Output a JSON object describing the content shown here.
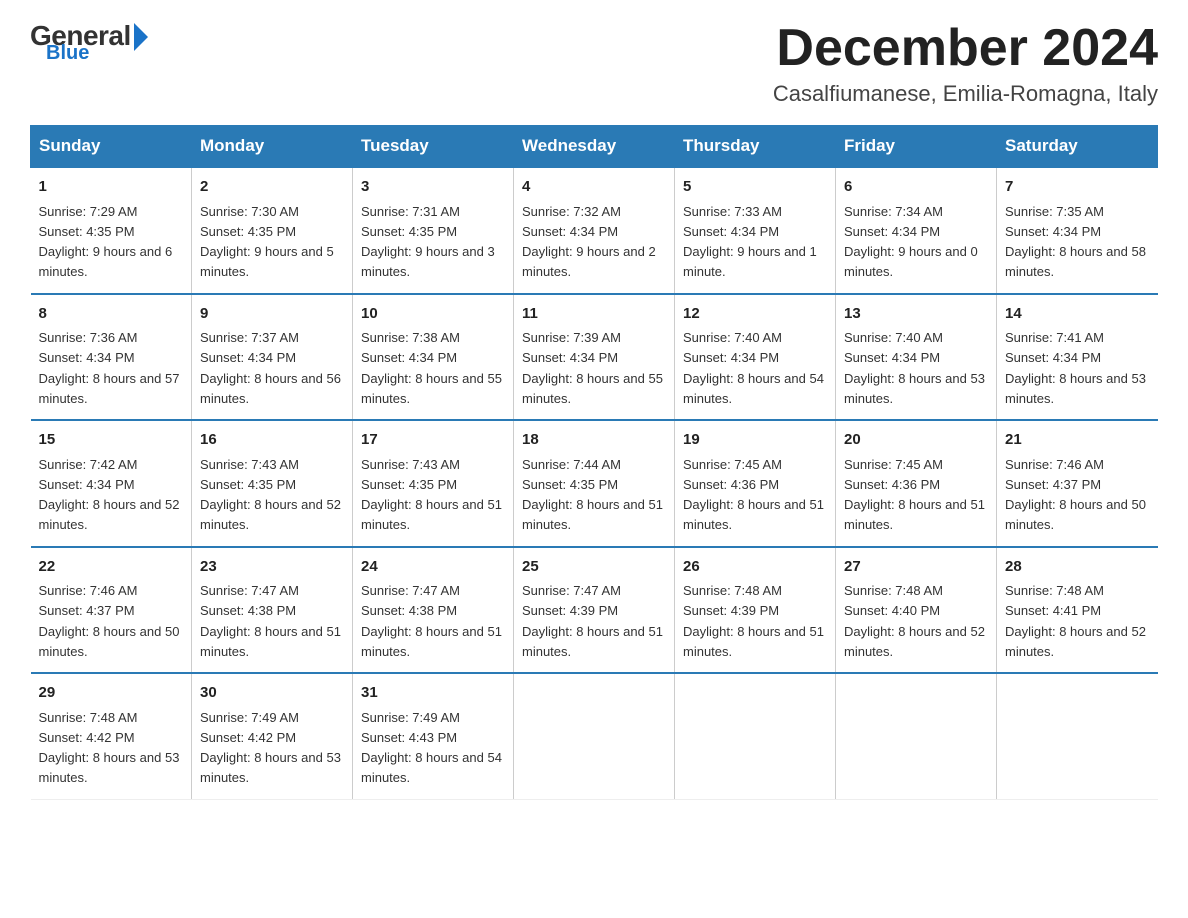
{
  "header": {
    "logo_general": "General",
    "logo_blue": "Blue",
    "month_title": "December 2024",
    "location": "Casalfiumanese, Emilia-Romagna, Italy"
  },
  "weekdays": [
    "Sunday",
    "Monday",
    "Tuesday",
    "Wednesday",
    "Thursday",
    "Friday",
    "Saturday"
  ],
  "weeks": [
    [
      {
        "day": "1",
        "sunrise": "7:29 AM",
        "sunset": "4:35 PM",
        "daylight": "9 hours and 6 minutes."
      },
      {
        "day": "2",
        "sunrise": "7:30 AM",
        "sunset": "4:35 PM",
        "daylight": "9 hours and 5 minutes."
      },
      {
        "day": "3",
        "sunrise": "7:31 AM",
        "sunset": "4:35 PM",
        "daylight": "9 hours and 3 minutes."
      },
      {
        "day": "4",
        "sunrise": "7:32 AM",
        "sunset": "4:34 PM",
        "daylight": "9 hours and 2 minutes."
      },
      {
        "day": "5",
        "sunrise": "7:33 AM",
        "sunset": "4:34 PM",
        "daylight": "9 hours and 1 minute."
      },
      {
        "day": "6",
        "sunrise": "7:34 AM",
        "sunset": "4:34 PM",
        "daylight": "9 hours and 0 minutes."
      },
      {
        "day": "7",
        "sunrise": "7:35 AM",
        "sunset": "4:34 PM",
        "daylight": "8 hours and 58 minutes."
      }
    ],
    [
      {
        "day": "8",
        "sunrise": "7:36 AM",
        "sunset": "4:34 PM",
        "daylight": "8 hours and 57 minutes."
      },
      {
        "day": "9",
        "sunrise": "7:37 AM",
        "sunset": "4:34 PM",
        "daylight": "8 hours and 56 minutes."
      },
      {
        "day": "10",
        "sunrise": "7:38 AM",
        "sunset": "4:34 PM",
        "daylight": "8 hours and 55 minutes."
      },
      {
        "day": "11",
        "sunrise": "7:39 AM",
        "sunset": "4:34 PM",
        "daylight": "8 hours and 55 minutes."
      },
      {
        "day": "12",
        "sunrise": "7:40 AM",
        "sunset": "4:34 PM",
        "daylight": "8 hours and 54 minutes."
      },
      {
        "day": "13",
        "sunrise": "7:40 AM",
        "sunset": "4:34 PM",
        "daylight": "8 hours and 53 minutes."
      },
      {
        "day": "14",
        "sunrise": "7:41 AM",
        "sunset": "4:34 PM",
        "daylight": "8 hours and 53 minutes."
      }
    ],
    [
      {
        "day": "15",
        "sunrise": "7:42 AM",
        "sunset": "4:34 PM",
        "daylight": "8 hours and 52 minutes."
      },
      {
        "day": "16",
        "sunrise": "7:43 AM",
        "sunset": "4:35 PM",
        "daylight": "8 hours and 52 minutes."
      },
      {
        "day": "17",
        "sunrise": "7:43 AM",
        "sunset": "4:35 PM",
        "daylight": "8 hours and 51 minutes."
      },
      {
        "day": "18",
        "sunrise": "7:44 AM",
        "sunset": "4:35 PM",
        "daylight": "8 hours and 51 minutes."
      },
      {
        "day": "19",
        "sunrise": "7:45 AM",
        "sunset": "4:36 PM",
        "daylight": "8 hours and 51 minutes."
      },
      {
        "day": "20",
        "sunrise": "7:45 AM",
        "sunset": "4:36 PM",
        "daylight": "8 hours and 51 minutes."
      },
      {
        "day": "21",
        "sunrise": "7:46 AM",
        "sunset": "4:37 PM",
        "daylight": "8 hours and 50 minutes."
      }
    ],
    [
      {
        "day": "22",
        "sunrise": "7:46 AM",
        "sunset": "4:37 PM",
        "daylight": "8 hours and 50 minutes."
      },
      {
        "day": "23",
        "sunrise": "7:47 AM",
        "sunset": "4:38 PM",
        "daylight": "8 hours and 51 minutes."
      },
      {
        "day": "24",
        "sunrise": "7:47 AM",
        "sunset": "4:38 PM",
        "daylight": "8 hours and 51 minutes."
      },
      {
        "day": "25",
        "sunrise": "7:47 AM",
        "sunset": "4:39 PM",
        "daylight": "8 hours and 51 minutes."
      },
      {
        "day": "26",
        "sunrise": "7:48 AM",
        "sunset": "4:39 PM",
        "daylight": "8 hours and 51 minutes."
      },
      {
        "day": "27",
        "sunrise": "7:48 AM",
        "sunset": "4:40 PM",
        "daylight": "8 hours and 52 minutes."
      },
      {
        "day": "28",
        "sunrise": "7:48 AM",
        "sunset": "4:41 PM",
        "daylight": "8 hours and 52 minutes."
      }
    ],
    [
      {
        "day": "29",
        "sunrise": "7:48 AM",
        "sunset": "4:42 PM",
        "daylight": "8 hours and 53 minutes."
      },
      {
        "day": "30",
        "sunrise": "7:49 AM",
        "sunset": "4:42 PM",
        "daylight": "8 hours and 53 minutes."
      },
      {
        "day": "31",
        "sunrise": "7:49 AM",
        "sunset": "4:43 PM",
        "daylight": "8 hours and 54 minutes."
      },
      null,
      null,
      null,
      null
    ]
  ],
  "labels": {
    "sunrise": "Sunrise:",
    "sunset": "Sunset:",
    "daylight": "Daylight:"
  }
}
